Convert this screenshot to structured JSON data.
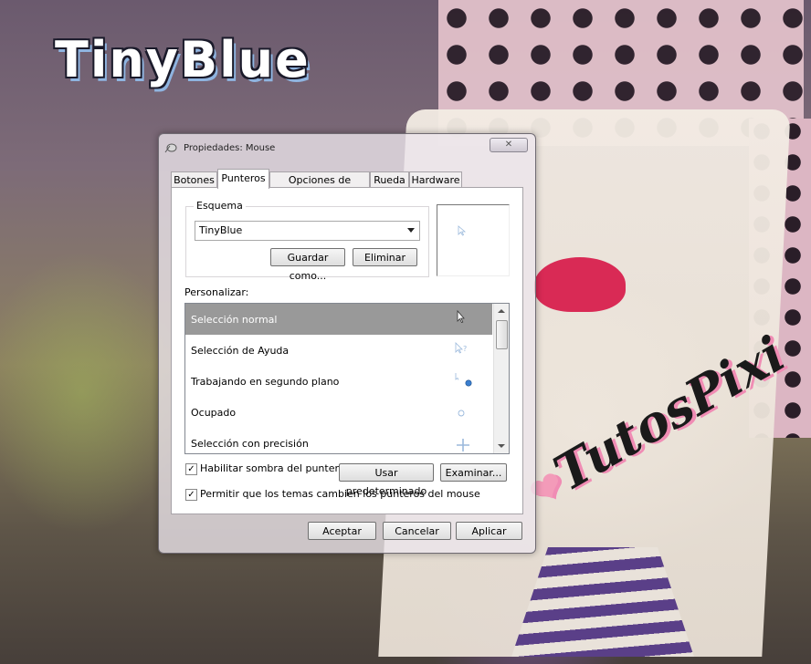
{
  "background": {
    "logo_text": "TinyBlue",
    "watermark_text": "TutosPixi"
  },
  "window": {
    "title": "Propiedades: Mouse",
    "close_glyph": "✕",
    "tabs": [
      {
        "label": "Botones"
      },
      {
        "label": "Punteros"
      },
      {
        "label": "Opciones de puntero"
      },
      {
        "label": "Rueda"
      },
      {
        "label": "Hardware"
      }
    ],
    "active_tab": "Punteros",
    "scheme": {
      "group_label": "Esquema",
      "selected_value": "TinyBlue",
      "save_as_label": "Guardar como...",
      "delete_label": "Eliminar"
    },
    "customize": {
      "label": "Personalizar:",
      "items": [
        {
          "label": "Selección normal",
          "cursor": "arrow-icon",
          "selected": true
        },
        {
          "label": "Selección de Ayuda",
          "cursor": "help-cursor-icon",
          "selected": false
        },
        {
          "label": "Trabajando en segundo plano",
          "cursor": "busy-background-icon",
          "selected": false
        },
        {
          "label": "Ocupado",
          "cursor": "busy-icon",
          "selected": false
        },
        {
          "label": "Selección con precisión",
          "cursor": "crosshair-icon",
          "selected": false
        }
      ]
    },
    "shadow_checkbox": {
      "label": "Habilitar sombra del puntero",
      "checked": true
    },
    "default_button": "Usar predeterminado",
    "browse_button": "Examinar...",
    "themes_checkbox": {
      "label": "Permitir que los temas cambien los punteros del mouse",
      "checked": true
    },
    "footer": {
      "ok": "Aceptar",
      "cancel": "Cancelar",
      "apply": "Aplicar"
    }
  },
  "colors": {
    "selection": "#999999",
    "cursor_accent": "#3a7fd0"
  }
}
